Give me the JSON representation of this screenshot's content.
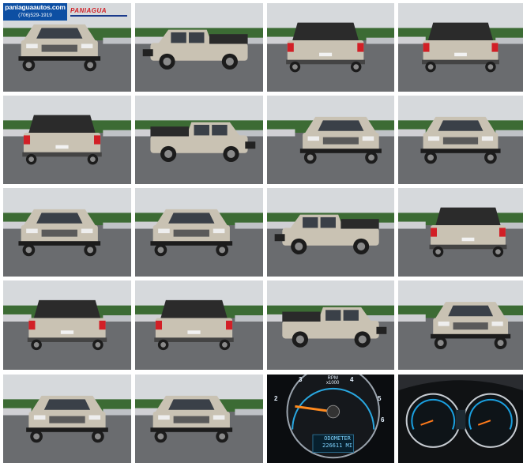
{
  "gallery": {
    "dealer_website": "paniaguaautos.com",
    "dealer_phone": "(706)529-1919",
    "dealer_brand": "PANIAGUA",
    "photos": [
      {
        "icon": "truck-front-left"
      },
      {
        "icon": "truck-side-left"
      },
      {
        "icon": "truck-rear-left"
      },
      {
        "icon": "truck-rear"
      },
      {
        "icon": "truck-rear-left"
      },
      {
        "icon": "truck-side-right"
      },
      {
        "icon": "truck-front-right"
      },
      {
        "icon": "truck-front"
      },
      {
        "icon": "truck-front-left"
      },
      {
        "icon": "truck-front-left"
      },
      {
        "icon": "truck-side-left"
      },
      {
        "icon": "truck-rear-right"
      },
      {
        "icon": "truck-rear"
      },
      {
        "icon": "truck-rear-left"
      },
      {
        "icon": "truck-side-right"
      },
      {
        "icon": "truck-front-right"
      },
      {
        "icon": "truck-front"
      },
      {
        "icon": "truck-front-left"
      },
      {
        "icon": "tachometer-gauge"
      },
      {
        "icon": "instrument-cluster"
      }
    ],
    "tachometer": {
      "label_line1": "RPM",
      "label_line2": "x1000",
      "gauge_numbers": [
        "2",
        "3",
        "4",
        "5",
        "6"
      ],
      "odometer_label": "ODOMETER",
      "odometer_value": "226611 MI"
    }
  },
  "colors": {
    "truck_body": "#c9c2b3",
    "sky": "#d6d9dc",
    "asphalt": "#6a6c6f",
    "trees": "#3c6b34",
    "logo_blue": "#0d4fa3",
    "brand_red": "#d21f26"
  }
}
